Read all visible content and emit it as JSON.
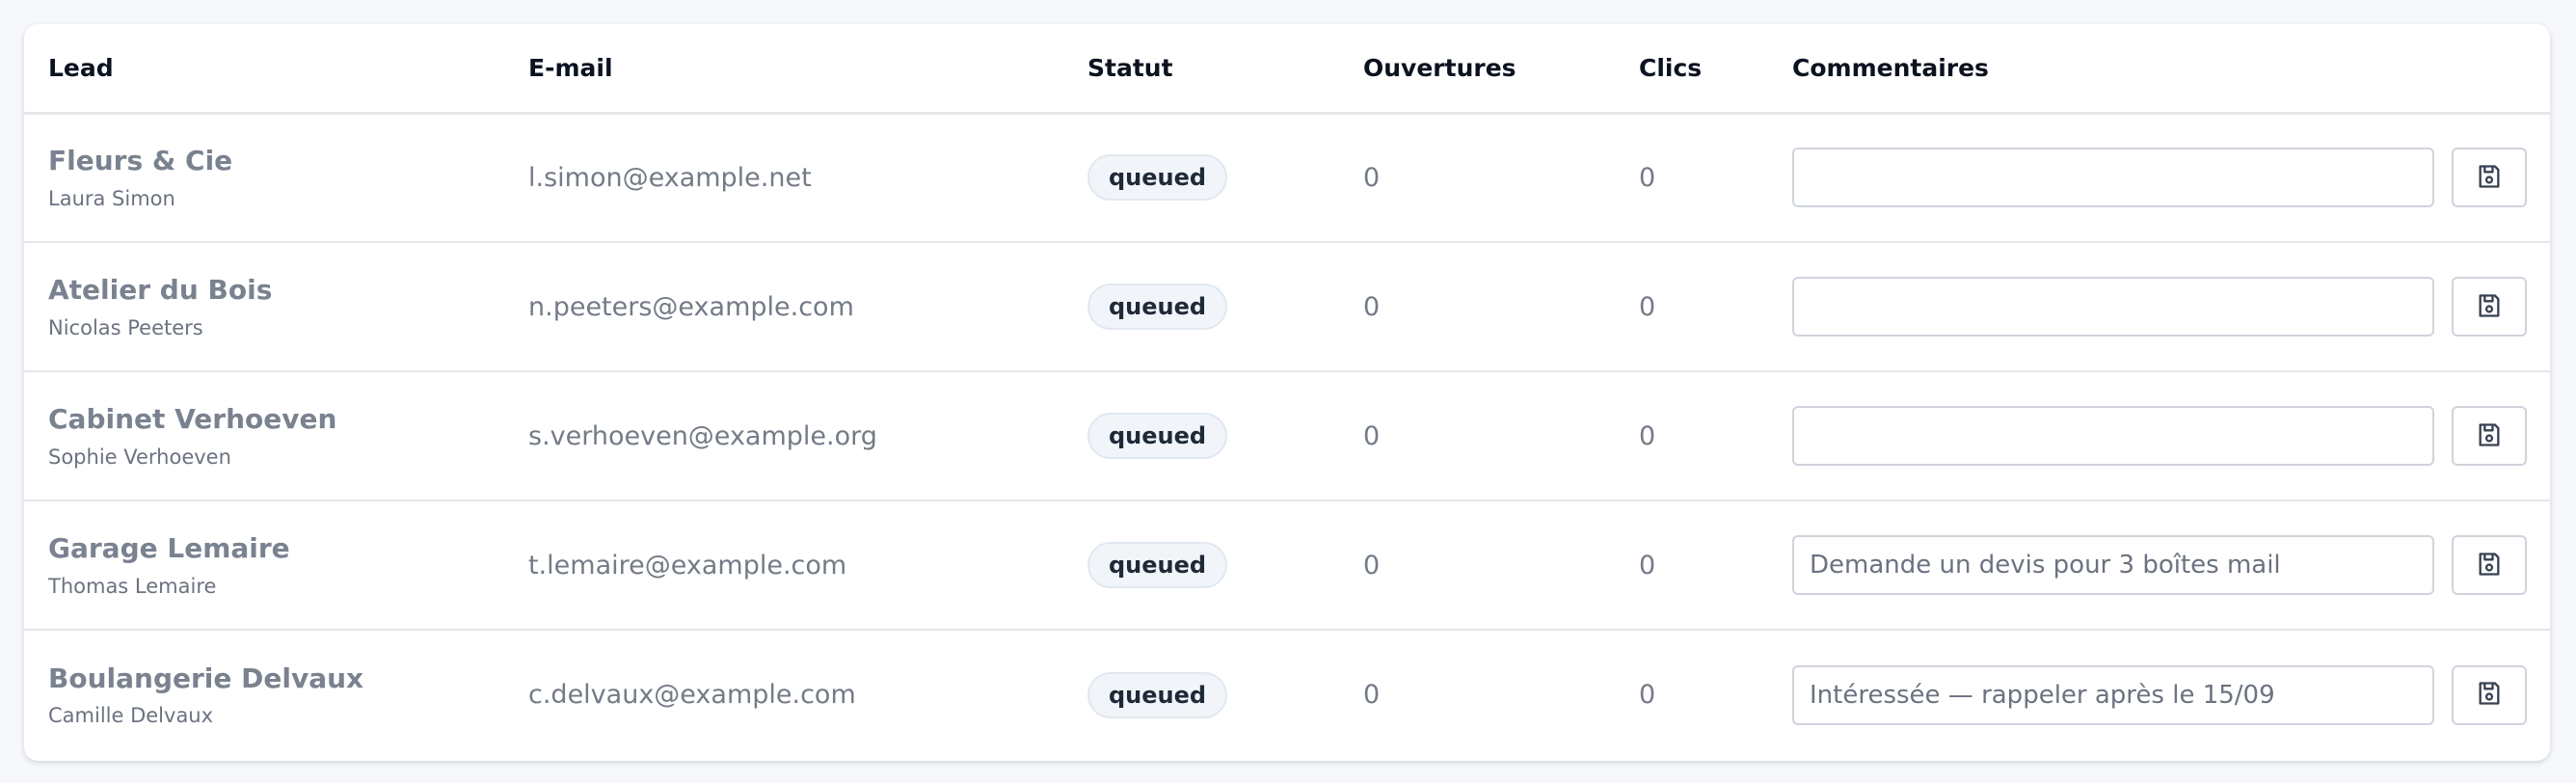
{
  "table": {
    "headers": {
      "lead": "Lead",
      "email": "E-mail",
      "status": "Statut",
      "opens": "Ouvertures",
      "clicks": "Clics",
      "comments": "Commentaires"
    },
    "rows": [
      {
        "company": "Fleurs & Cie",
        "contact": "Laura Simon",
        "email": "l.simon@example.net",
        "status": "queued",
        "opens": "0",
        "clicks": "0",
        "comment": "",
        "save_icon": "save-icon"
      },
      {
        "company": "Atelier du Bois",
        "contact": "Nicolas Peeters",
        "email": "n.peeters@example.com",
        "status": "queued",
        "opens": "0",
        "clicks": "0",
        "comment": "",
        "save_icon": "save-icon"
      },
      {
        "company": "Cabinet Verhoeven",
        "contact": "Sophie Verhoeven",
        "email": "s.verhoeven@example.org",
        "status": "queued",
        "opens": "0",
        "clicks": "0",
        "comment": "",
        "save_icon": "save-icon"
      },
      {
        "company": "Garage Lemaire",
        "contact": "Thomas Lemaire",
        "email": "t.lemaire@example.com",
        "status": "queued",
        "opens": "0",
        "clicks": "0",
        "comment": "Demande un devis pour 3 boîtes mail",
        "save_icon": "save-icon"
      },
      {
        "company": "Boulangerie Delvaux",
        "contact": "Camille Delvaux",
        "email": "c.delvaux@example.com",
        "status": "queued",
        "opens": "0",
        "clicks": "0",
        "comment": "Intéressée — rappeler après le 15/09",
        "save_icon": "save-icon"
      }
    ]
  },
  "colors": {
    "page_background": "#f6f8fb",
    "card_background": "#ffffff",
    "badge_background": "#f1f5f9",
    "border": "#e5e7eb"
  }
}
